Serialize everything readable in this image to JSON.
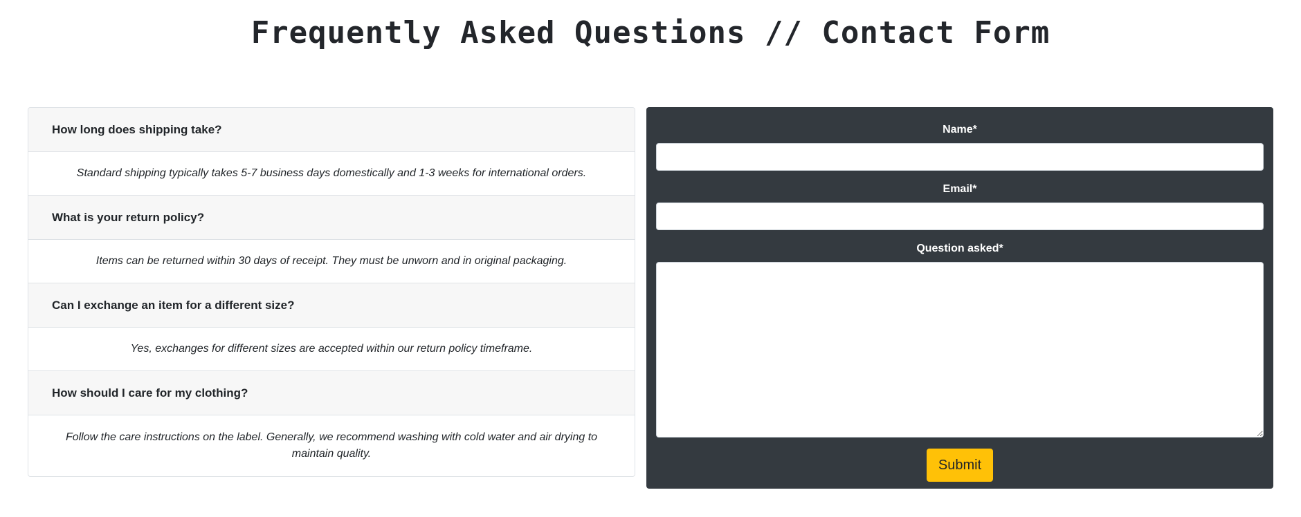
{
  "page": {
    "title": "Frequently Asked Questions // Contact Form"
  },
  "faq": {
    "items": [
      {
        "question": "How long does shipping take?",
        "answer": "Standard shipping typically takes 5-7 business days domestically and 1-3 weeks for international orders."
      },
      {
        "question": "What is your return policy?",
        "answer": "Items can be returned within 30 days of receipt. They must be unworn and in original packaging."
      },
      {
        "question": "Can I exchange an item for a different size?",
        "answer": "Yes, exchanges for different sizes are accepted within our return policy timeframe."
      },
      {
        "question": "How should I care for my clothing?",
        "answer": "Follow the care instructions on the label. Generally, we recommend washing with cold water and air drying to maintain quality."
      }
    ]
  },
  "contact": {
    "name_label": "Name*",
    "name_value": "",
    "email_label": "Email*",
    "email_value": "",
    "question_label": "Question asked*",
    "question_value": "",
    "submit_label": "Submit"
  },
  "colors": {
    "form_background": "#343a40",
    "submit_button": "#ffc107",
    "faq_header_background": "#f7f7f7"
  }
}
